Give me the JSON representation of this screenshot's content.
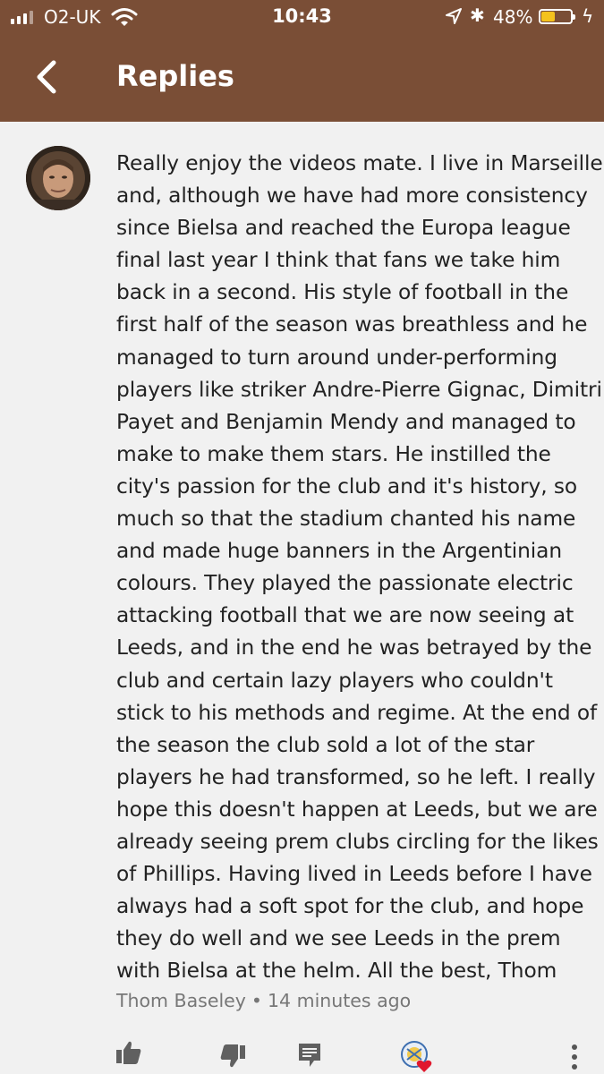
{
  "status_bar": {
    "carrier": "O2-UK",
    "time": "10:43",
    "battery_percent": "48%",
    "battery_level": 0.48,
    "signal_bars_filled": 3,
    "signal_bars_total": 4,
    "icons": [
      "signal-icon",
      "wifi-icon",
      "location-icon",
      "bluetooth-icon",
      "battery-icon",
      "charging-icon"
    ]
  },
  "header": {
    "title": "Replies",
    "back_icon": "back-arrow-icon",
    "color": "#7a4e36"
  },
  "comment": {
    "lines": [
      "Really enjoy the videos mate. I live in Marseille",
      "and, although we have had more consistency",
      "since Bielsa and reached the Europa league",
      "final last year I think that fans we take him",
      "back in a second. His style of football in the",
      "first half of the season was breathless and he",
      "managed to turn around under-performing",
      "players like striker Andre-Pierre Gignac, Dimitri",
      "Payet and Benjamin Mendy and managed to",
      "make to make them stars. He instilled the",
      "city's passion for the club and it's history, so",
      "much so that the stadium chanted his name",
      "and made huge banners in the Argentinian",
      "colours. They played the passionate electric",
      "attacking football that we are now seeing at",
      "Leeds, and in the end he was betrayed by the",
      "club and certain lazy players who couldn't",
      "stick to his methods and regime. At the end of",
      "the season the club sold a lot of the star",
      "players he had transformed, so he left. I really",
      "hope this doesn't happen at Leeds, but we are",
      "already seeing prem clubs circling for the likes",
      "of Phillips. Having lived in Leeds before I have",
      "always had a soft spot for the club, and hope",
      "they do well and we see Leeds in the prem",
      "with Bielsa at the helm. All the best, Thom"
    ],
    "author": "Thom Baseley",
    "separator": "•",
    "time_ago": "14 minutes ago"
  },
  "actions": {
    "icons": [
      "thumbs-up-icon",
      "thumbs-down-icon",
      "reply-icon",
      "creator-heart-icon",
      "more-options-icon"
    ]
  }
}
